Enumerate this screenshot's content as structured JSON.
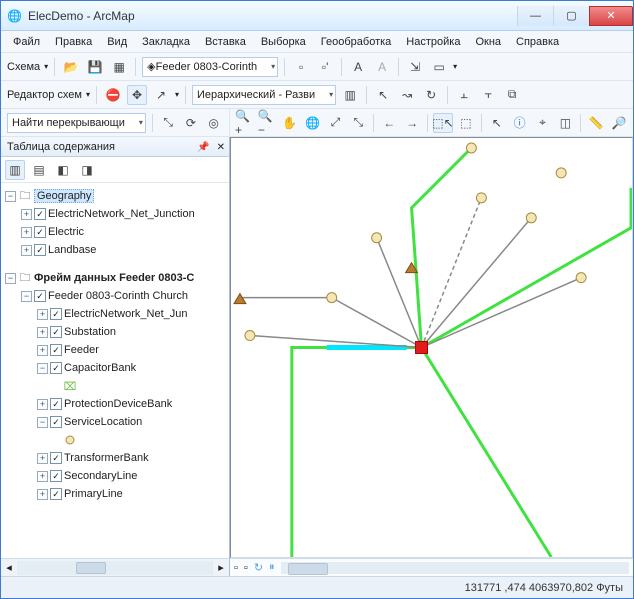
{
  "window": {
    "title": "ElecDemo - ArcMap"
  },
  "menu": {
    "file": "Файл",
    "edit": "Правка",
    "view": "Вид",
    "bookmarks": "Закладка",
    "insert": "Вставка",
    "selection": "Выборка",
    "geoprocessing": "Геообработка",
    "customize": "Настройка",
    "windows": "Окна",
    "help": "Справка"
  },
  "toolbar1": {
    "label": "Схема",
    "feeder": "Feeder 0803-Corinth"
  },
  "toolbar2": {
    "label": "Редактор схем",
    "layout": "Иерархический - Разви"
  },
  "toolbar3": {
    "combo": "Найти перекрывающи"
  },
  "toc": {
    "title": "Таблица содержания",
    "root1": {
      "name": "Geography",
      "items": [
        "ElectricNetwork_Net_Junction",
        "Electric",
        "Landbase"
      ]
    },
    "root2": {
      "name": "Фрейм данных Feeder 0803-C",
      "feeder": "Feeder 0803-Corinth Church",
      "layers": [
        "ElectricNetwork_Net_Jun",
        "Substation",
        "Feeder",
        "CapacitorBank",
        "ProtectionDeviceBank",
        "ServiceLocation",
        "TransformerBank",
        "SecondaryLine",
        "PrimaryLine"
      ]
    }
  },
  "status": {
    "coords": "131771 ,474 4063970,802 Футы"
  },
  "icons": {
    "min": "—",
    "max": "▢",
    "close": "✕",
    "dropdown": "▾",
    "pin": "📌",
    "x": "✕",
    "layersA": "▥",
    "layersB": "▤",
    "layersC": "◧",
    "layersD": "◨",
    "folder": "📁",
    "save": "💾",
    "group": "▭",
    "fullext": "◎",
    "arrowL": "⟵",
    "arrowR": "⟶",
    "cursor": "↖",
    "info": "ⓘ",
    "measure": "📏",
    "find": "🔍",
    "globe": "🌐",
    "hand": "✋",
    "zoomin": "+",
    "zoomout": "−",
    "play": "▶",
    "pause": "⏸",
    "stop": "⏹",
    "refresh": "↻",
    "checkbox": "✓"
  }
}
